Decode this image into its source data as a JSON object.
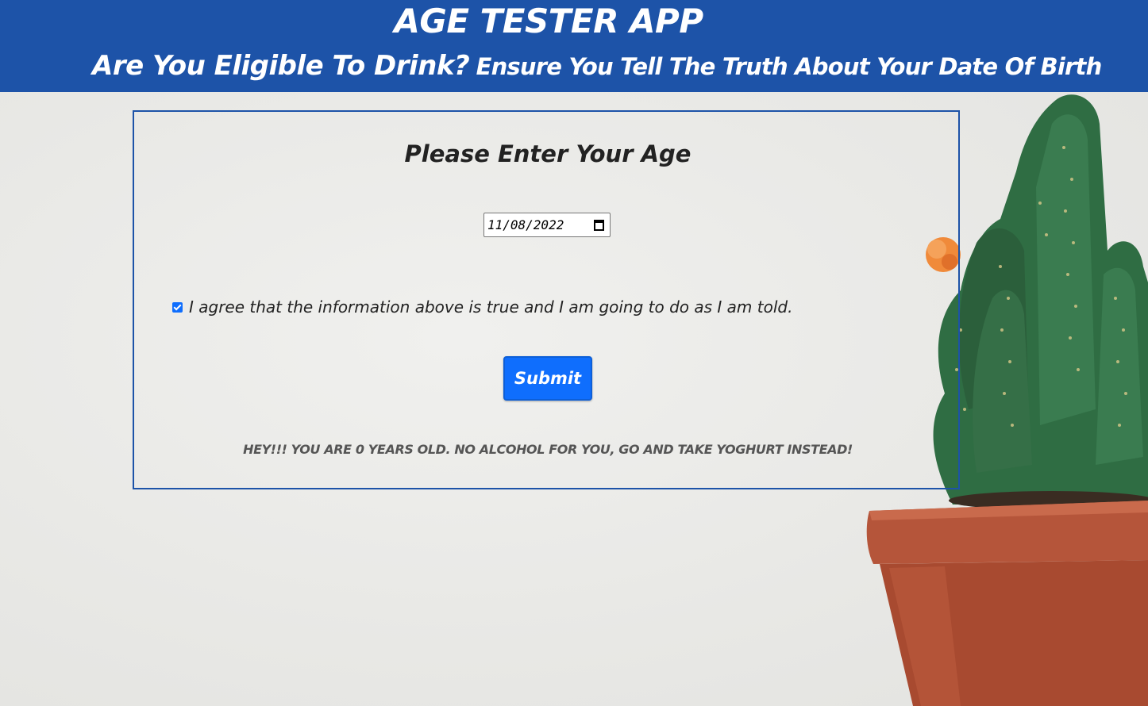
{
  "header": {
    "title": "AGE TESTER APP",
    "subtitle_question": "Are You Eligible To Drink?",
    "subtitle_note": "Ensure You Tell The Truth About Your Date Of Birth"
  },
  "form": {
    "heading": "Please Enter Your Age",
    "dob_value": "11/08/2022",
    "dob_icon": "calendar-icon",
    "agree_checked": true,
    "agree_label": "I agree that the information above is true and I am going to do as I am told.",
    "submit_label": "Submit",
    "result_message": "HEY!!! YOU ARE 0 YEARS OLD. NO ALCOHOL FOR YOU, GO AND TAKE YOGHURT INSTEAD!"
  },
  "colors": {
    "header_bg": "#1d53a8",
    "accent": "#0f6efd",
    "card_border": "#1d53a8"
  }
}
